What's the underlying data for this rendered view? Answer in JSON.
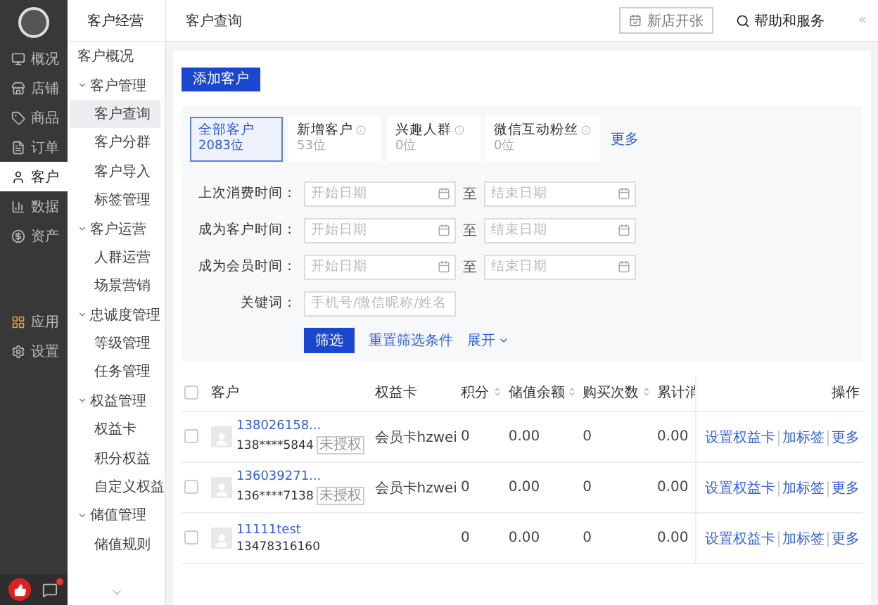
{
  "sidebar": {
    "items": [
      {
        "label": "概况",
        "selected": false
      },
      {
        "label": "店铺",
        "selected": false
      },
      {
        "label": "商品",
        "selected": false
      },
      {
        "label": "订单",
        "selected": false
      },
      {
        "label": "客户",
        "selected": true
      },
      {
        "label": "数据",
        "selected": false
      },
      {
        "label": "资产",
        "selected": false
      }
    ],
    "bottom_items": [
      {
        "label": "应用",
        "selected": false
      },
      {
        "label": "设置",
        "selected": false
      }
    ]
  },
  "sub_nav": {
    "title": "客户经营",
    "items": [
      {
        "label": "客户概况",
        "selected": false
      },
      {
        "label": "客户管理",
        "selected": false,
        "expanded": true,
        "children": [
          {
            "label": "客户查询",
            "selected": true
          },
          {
            "label": "客户分群",
            "selected": false
          },
          {
            "label": "客户导入",
            "selected": false
          },
          {
            "label": "标签管理",
            "selected": false
          }
        ]
      },
      {
        "label": "客户运营",
        "selected": false,
        "expanded": true,
        "children": [
          {
            "label": "人群运营",
            "selected": false
          },
          {
            "label": "场景营销",
            "selected": false
          }
        ]
      },
      {
        "label": "忠诚度管理",
        "selected": false,
        "expanded": true,
        "children": [
          {
            "label": "等级管理",
            "selected": false
          },
          {
            "label": "任务管理",
            "selected": false
          }
        ]
      },
      {
        "label": "权益管理",
        "selected": false,
        "expanded": true,
        "children": [
          {
            "label": "权益卡",
            "selected": false
          },
          {
            "label": "积分权益",
            "selected": false
          },
          {
            "label": "自定义权益",
            "selected": false
          }
        ]
      },
      {
        "label": "储值管理",
        "selected": false,
        "expanded": true,
        "children": [
          {
            "label": "储值规则",
            "selected": false
          }
        ]
      }
    ]
  },
  "header": {
    "title": "客户查询",
    "open_store_button": "新店开张",
    "help_link": "帮助和服务",
    "collapse": "«"
  },
  "add_button": "添加客户",
  "segments": [
    {
      "label": "全部客户",
      "count": "2083位",
      "info": false,
      "selected": true
    },
    {
      "label": "新增客户",
      "count": "53位",
      "info": true,
      "selected": false
    },
    {
      "label": "兴趣人群",
      "count": "0位",
      "info": true,
      "selected": false
    },
    {
      "label": "微信互动粉丝",
      "count": "0位",
      "info": true,
      "selected": false
    }
  ],
  "more_link": "更多",
  "date_filters": [
    {
      "label": "上次消费时间：",
      "start_placeholder": "开始日期",
      "separator": "至",
      "end_placeholder": "结束日期"
    },
    {
      "label": "成为客户时间：",
      "start_placeholder": "开始日期",
      "separator": "至",
      "end_placeholder": "结束日期"
    },
    {
      "label": "成为会员时间：",
      "start_placeholder": "开始日期",
      "separator": "至",
      "end_placeholder": "结束日期"
    }
  ],
  "keyword": {
    "label": "关键词：",
    "placeholder": "手机号/微信昵称/姓名"
  },
  "filter_button": "筛选",
  "reset_link": "重置筛选条件",
  "expand_link": "展开",
  "table": {
    "select_all_checked": false,
    "columns": [
      {
        "label": "客户"
      },
      {
        "label": "权益卡"
      },
      {
        "label": "积分",
        "sortable": true
      },
      {
        "label": "储值余额",
        "sortable": true
      },
      {
        "label": "购买次数",
        "sortable": true
      },
      {
        "label": "累计消"
      },
      {
        "label": "操作"
      }
    ],
    "rows": [
      {
        "checked": false,
        "name": "138026158...",
        "phone": "138****5844",
        "tag": "未授权",
        "card": "会员卡hzwei",
        "points": "0",
        "balance": "0.00",
        "purchases": "0",
        "total": "0.00",
        "actions": [
          "设置权益卡",
          "加标签",
          "更多"
        ]
      },
      {
        "checked": false,
        "name": "136039271...",
        "phone": "136****7138",
        "tag": "未授权",
        "card": "会员卡hzwei",
        "points": "0",
        "balance": "0.00",
        "purchases": "0",
        "total": "0.00",
        "actions": [
          "设置权益卡",
          "加标签",
          "更多"
        ]
      },
      {
        "checked": false,
        "name": "11111test",
        "phone": "13478316160",
        "points": "0",
        "balance": "0.00",
        "purchases": "0",
        "total": "0.00",
        "actions": [
          "设置权益卡",
          "加标签",
          "更多"
        ]
      }
    ]
  }
}
